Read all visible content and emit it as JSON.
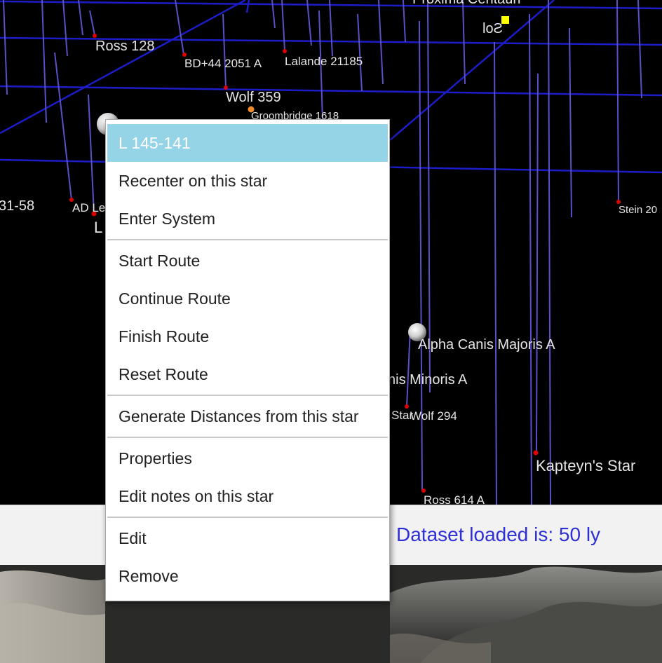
{
  "starmap": {
    "labels": {
      "proxima_centauri": "Proxima Centauri",
      "ross_128": "Ross 128",
      "bd44_2051a": "BD+44  2051 A",
      "lalande_21185": "Lalande 21185",
      "wolf_359": "Wolf 359",
      "groombridge_1618": "Groombridge 1618",
      "left_cut": "31-58",
      "ad_leo": "AD Le",
      "l_fragment": "L",
      "stein_20": "Stein 20",
      "alpha_canis_majoris": "Alpha Canis Majoris A",
      "canis_minoris": "nis Minoris A",
      "star_fragment": "Star",
      "wolf_294": "Wolf  294",
      "kapteyns_star": "Kapteyn's Star",
      "ross_614": "Ross 614 A",
      "sol": "Sol"
    },
    "colors": {
      "grid": "#1c1cc8",
      "drop_line": "#5a50c8",
      "star_marker": "#e00000",
      "sol_marker": "#ffff00"
    }
  },
  "status_bar": {
    "dataset_text": "Dataset loaded is: 50 ly"
  },
  "context_menu": {
    "title": "L 145-141",
    "recenter": "Recenter on this star",
    "enter_system": "Enter System",
    "start_route": "Start Route",
    "continue_route": "Continue Route",
    "finish_route": "Finish Route",
    "reset_route": "Reset Route",
    "generate_distances": "Generate Distances from this star",
    "properties": "Properties",
    "edit_notes": "Edit notes on this star",
    "edit": "Edit",
    "remove": "Remove"
  }
}
